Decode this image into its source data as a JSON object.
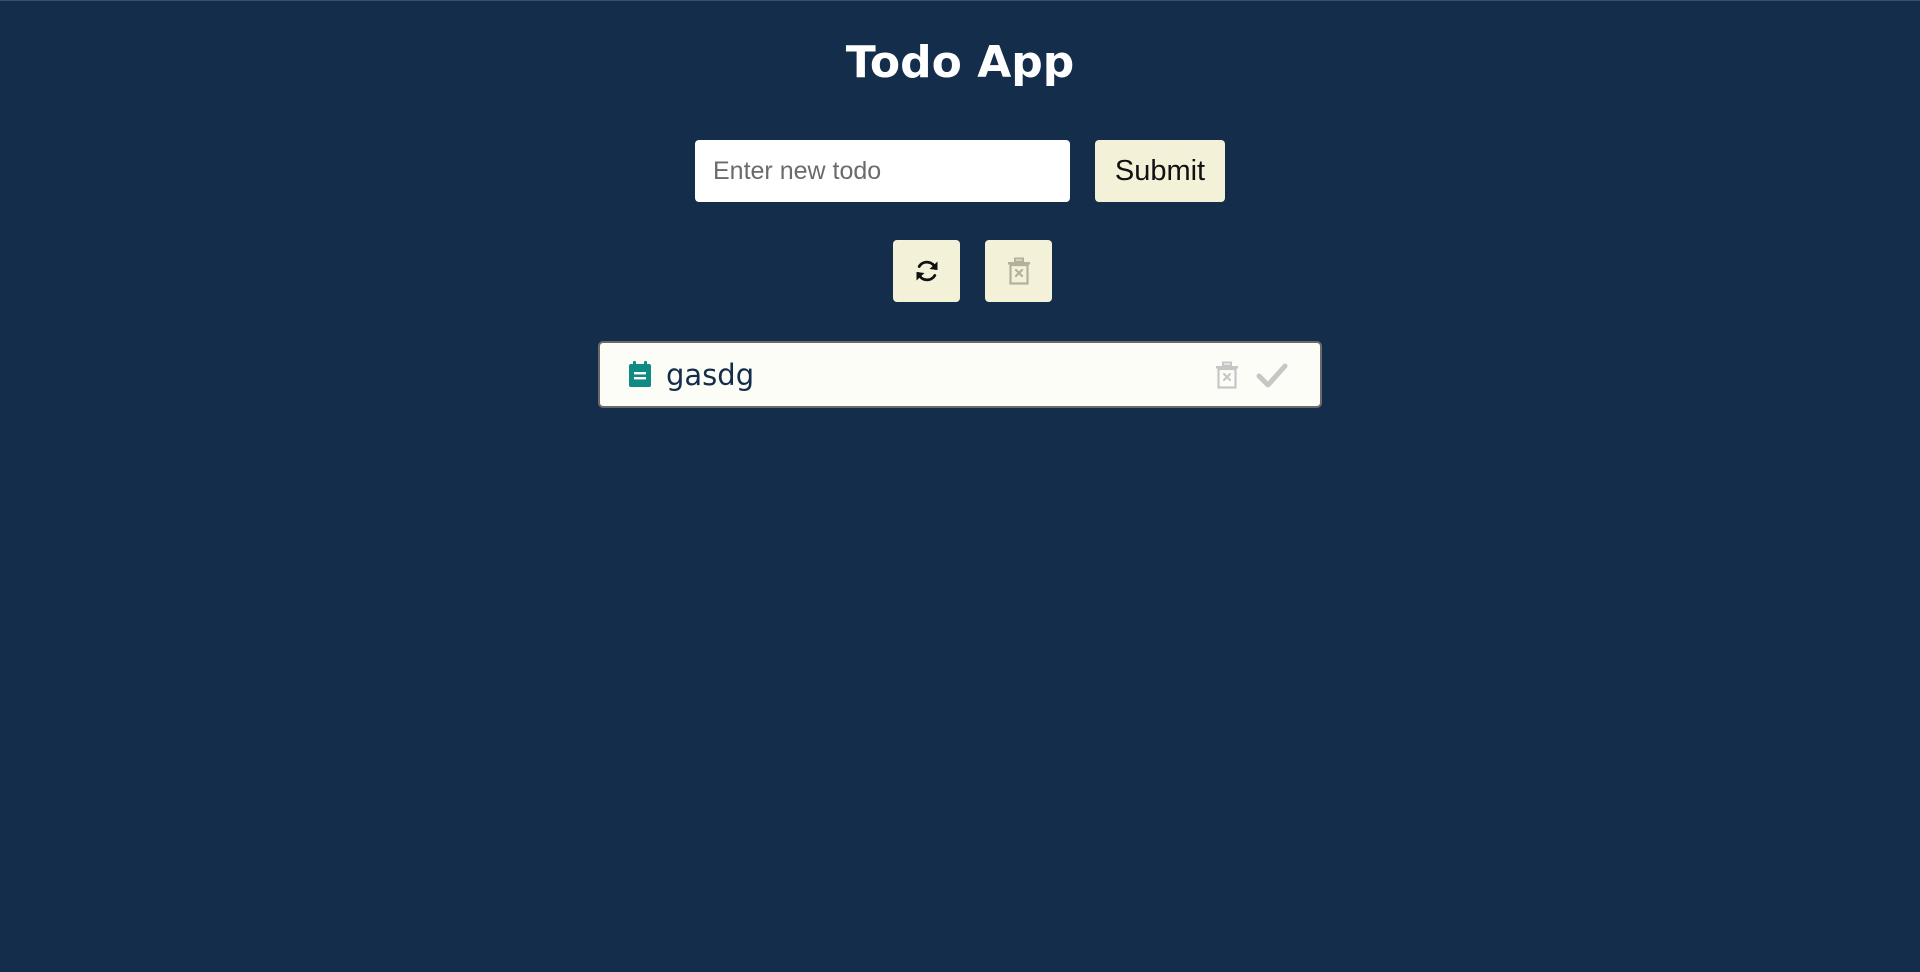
{
  "app": {
    "title": "Todo App"
  },
  "form": {
    "input_value": "",
    "input_placeholder": "Enter new todo",
    "submit_label": "Submit"
  },
  "toolbar": {
    "refresh_icon": "refresh-icon",
    "clear_icon": "trash-x-icon"
  },
  "todos": [
    {
      "text": "gasdg",
      "icon": "clipboard-icon",
      "completed": false
    }
  ],
  "colors": {
    "background": "#132d4b",
    "button": "#f3f2d9",
    "item_background": "#fdfdf7",
    "item_icon": "#0f8a84",
    "muted_icon": "#c6c6c6"
  }
}
